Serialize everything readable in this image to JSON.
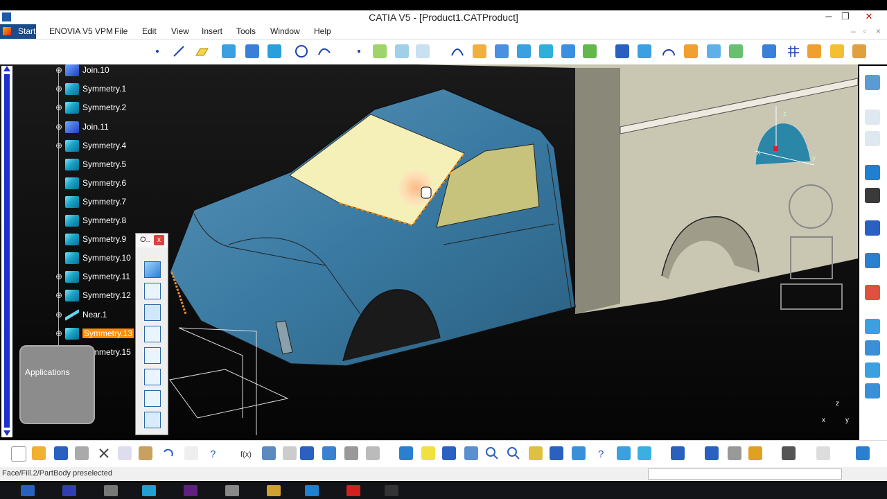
{
  "window": {
    "title": "CATIA V5 - [Product1.CATProduct]",
    "minimize": "─",
    "restore": "❐",
    "close": "✕"
  },
  "menu": {
    "start": "Start",
    "items": [
      "ENOVIA V5 VPM",
      "File",
      "Edit",
      "View",
      "Insert",
      "Tools",
      "Window",
      "Help"
    ]
  },
  "tree": {
    "nodes": [
      {
        "label": "Join.10",
        "icon": "join-icon"
      },
      {
        "label": "Symmetry.1",
        "icon": "symmetry-icon"
      },
      {
        "label": "Symmetry.2",
        "icon": "symmetry-icon"
      },
      {
        "label": "Join.11",
        "icon": "join-icon"
      },
      {
        "label": "Symmetry.4",
        "icon": "symmetry-icon"
      },
      {
        "label": "Symmetry.5",
        "icon": "symmetry-icon"
      },
      {
        "label": "Symmetry.6",
        "icon": "symmetry-icon"
      },
      {
        "label": "Symmetry.7",
        "icon": "symmetry-icon"
      },
      {
        "label": "Symmetry.8",
        "icon": "symmetry-icon"
      },
      {
        "label": "Symmetry.9",
        "icon": "symmetry-icon"
      },
      {
        "label": "Symmetry.10",
        "icon": "symmetry-icon"
      },
      {
        "label": "Symmetry.11",
        "icon": "symmetry-icon"
      },
      {
        "label": "Symmetry.12",
        "icon": "symmetry-icon"
      },
      {
        "label": "Near.1",
        "icon": "near-icon"
      },
      {
        "label": "Symmetry.13",
        "icon": "symmetry-icon",
        "selected": true
      },
      {
        "label": "Symmetry.15",
        "icon": "symmetry-icon"
      }
    ],
    "applications": "Applications"
  },
  "floating_toolbar": {
    "title": "O..",
    "close": "x"
  },
  "status": {
    "text": "Face/Fill.2/PartBody preselected"
  },
  "compass": {
    "z": "z",
    "x": "x",
    "y": "y"
  },
  "colors": {
    "selection": "#ff8c00",
    "tree_scroll": "#1c2fd0",
    "body": "#3f7ea6",
    "highlight": "#f4f0b8"
  }
}
